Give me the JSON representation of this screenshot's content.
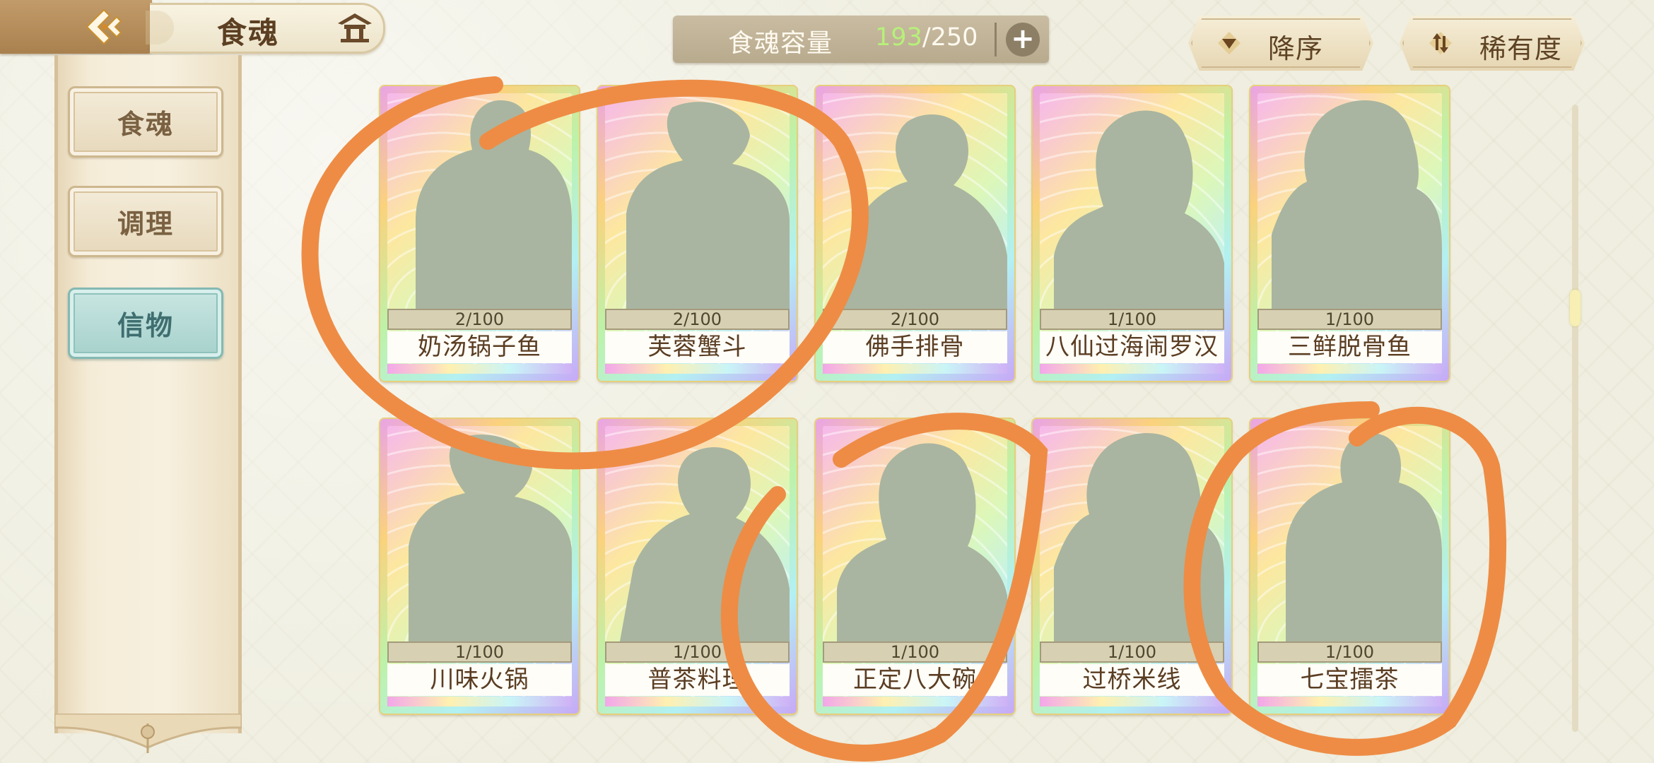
{
  "header": {
    "back_icon": "back-arrow-icon",
    "title": "食魂",
    "home_icon": "pavilion-home-icon"
  },
  "sidebar": {
    "items": [
      {
        "label": "食魂",
        "active": false
      },
      {
        "label": "调理",
        "active": false
      },
      {
        "label": "信物",
        "active": true
      }
    ]
  },
  "capacity": {
    "label": "食魂容量",
    "current": "193",
    "max": "/250",
    "add_icon": "plus-icon"
  },
  "sort": {
    "order_label": "降序",
    "order_icon": "triangle-down-icon",
    "rarity_label": "稀有度",
    "rarity_icon": "swap-icon"
  },
  "cards": [
    {
      "name": "奶汤锅子鱼",
      "progress": "2/100"
    },
    {
      "name": "芙蓉蟹斗",
      "progress": "2/100"
    },
    {
      "name": "佛手排骨",
      "progress": "2/100"
    },
    {
      "name": "八仙过海闹罗汉",
      "progress": "1/100"
    },
    {
      "name": "三鲜脱骨鱼",
      "progress": "1/100"
    },
    {
      "name": "川味火锅",
      "progress": "1/100"
    },
    {
      "name": "普茶料理",
      "progress": "1/100"
    },
    {
      "name": "正定八大碗",
      "progress": "1/100"
    },
    {
      "name": "过桥米线",
      "progress": "1/100"
    },
    {
      "name": "七宝擂茶",
      "progress": "1/100"
    }
  ],
  "colors": {
    "annotation": "#ee8c45",
    "capacity_current": "#b6f07a",
    "active_tab": "#a7d1cc"
  }
}
